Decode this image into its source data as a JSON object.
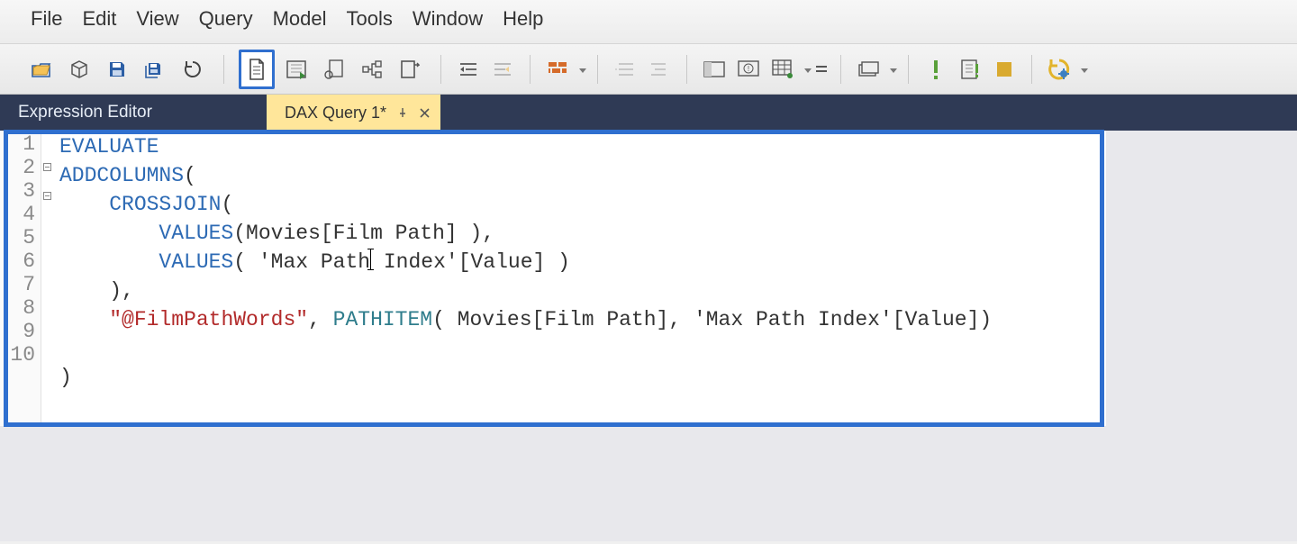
{
  "menu": {
    "items": [
      "File",
      "Edit",
      "View",
      "Query",
      "Model",
      "Tools",
      "Window",
      "Help"
    ]
  },
  "toolbar": {
    "icons": [
      "folder-open-icon",
      "cube-icon",
      "save-icon",
      "save-all-icon",
      "refresh-icon",
      "new-document-icon",
      "run-sheet-icon",
      "circle-doc-icon",
      "diagram-icon",
      "rect-swap-icon",
      "indent-left-icon",
      "indent-right-icon",
      "bricks-icon",
      "dedent-icon",
      "indent-icon",
      "split-left-icon",
      "split-warn-icon",
      "grid-settings-icon",
      "equals-icon",
      "layers-icon",
      "exclaim-icon",
      "note-exclaim-icon",
      "stop-icon",
      "gear-cycle-icon"
    ]
  },
  "tabs": {
    "expression_editor_label": "Expression Editor",
    "active_label": "DAX Query 1*"
  },
  "editor": {
    "line_numbers": [
      "1",
      "2",
      "3",
      "4",
      "5",
      "6",
      "7",
      "8",
      "9",
      "10"
    ],
    "code_lines": [
      {
        "tokens": [
          {
            "t": "EVALUATE",
            "c": "kw"
          }
        ]
      },
      {
        "tokens": [
          {
            "t": "ADDCOLUMNS",
            "c": "kw"
          },
          {
            "t": "(",
            "c": ""
          }
        ]
      },
      {
        "tokens": [
          {
            "t": "    ",
            "c": ""
          },
          {
            "t": "CROSSJOIN",
            "c": "kw"
          },
          {
            "t": "(",
            "c": ""
          }
        ]
      },
      {
        "tokens": [
          {
            "t": "        ",
            "c": ""
          },
          {
            "t": "VALUES",
            "c": "kw"
          },
          {
            "t": "(Movies[Film Path] ),",
            "c": ""
          }
        ]
      },
      {
        "tokens": [
          {
            "t": "        ",
            "c": ""
          },
          {
            "t": "VALUES",
            "c": "kw"
          },
          {
            "t": "( 'Max Path",
            "c": ""
          },
          {
            "t": "",
            "c": "caret"
          },
          {
            "t": " Index'[Value] )",
            "c": ""
          }
        ]
      },
      {
        "tokens": [
          {
            "t": "    ),",
            "c": ""
          }
        ]
      },
      {
        "tokens": [
          {
            "t": "    ",
            "c": ""
          },
          {
            "t": "\"@FilmPathWords\"",
            "c": "str"
          },
          {
            "t": ", ",
            "c": ""
          },
          {
            "t": "PATHITEM",
            "c": "func"
          },
          {
            "t": "( Movies[Film Path], 'Max Path Index'[Value])",
            "c": ""
          }
        ]
      },
      {
        "tokens": []
      },
      {
        "tokens": [
          {
            "t": ")",
            "c": ""
          }
        ]
      },
      {
        "tokens": []
      }
    ]
  }
}
